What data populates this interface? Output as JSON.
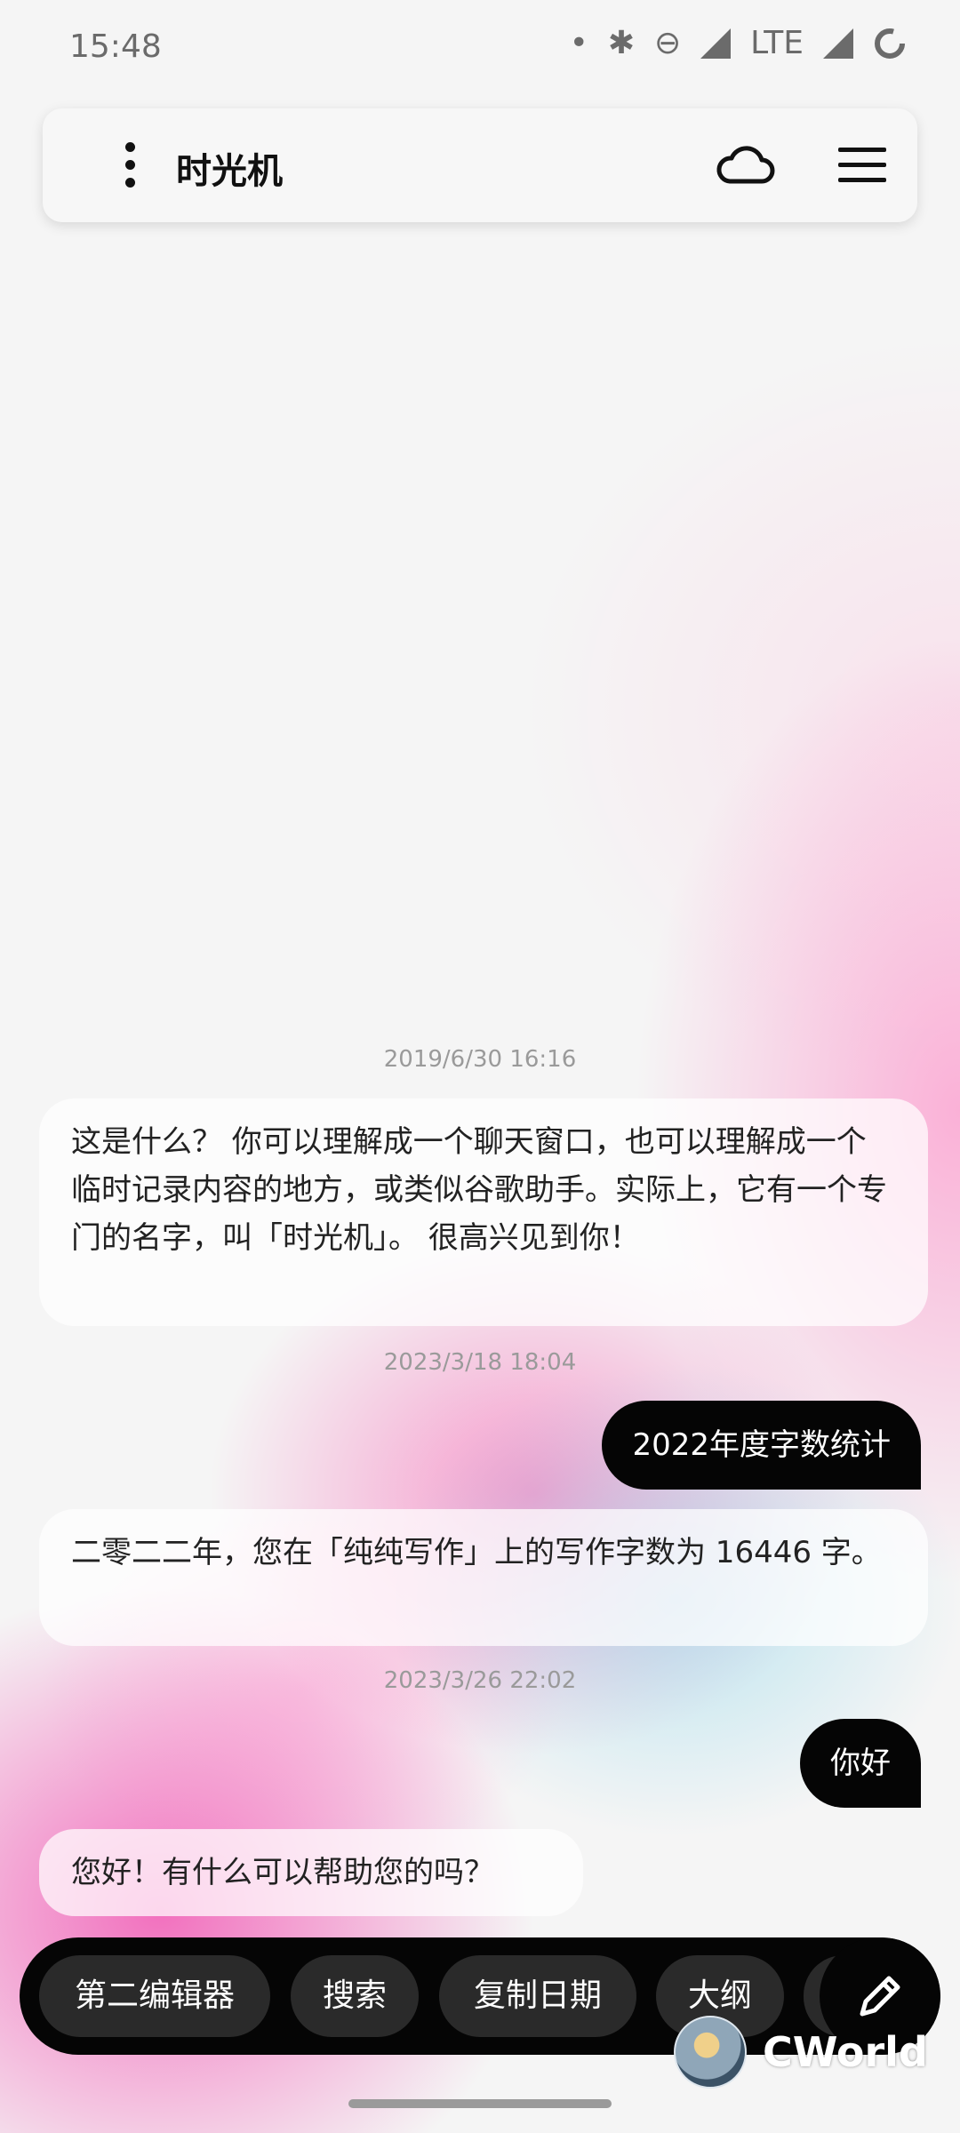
{
  "status_bar": {
    "time": "15:48",
    "network": "LTE"
  },
  "app_bar": {
    "title": "时光机"
  },
  "messages": [
    {
      "timestamp": "2019/6/30 16:16"
    },
    {
      "text": "这是什么？ 你可以理解成一个聊天窗口，也可以理解成一个临时记录内容的地方，或类似谷歌助手。实际上，它有一个专门的名字，叫「时光机」。 很高兴见到你！"
    },
    {
      "timestamp": "2023/3/18 18:04"
    },
    {
      "text": "2022年度字数统计"
    },
    {
      "text": "二零二二年，您在「纯纯写作」上的写作字数为 16446 字。"
    },
    {
      "timestamp": "2023/3/26 22:02"
    },
    {
      "text": "你好"
    },
    {
      "text": "您好！有什么可以帮助您的吗？"
    }
  ],
  "toolbar": {
    "buttons": [
      "第二编辑器",
      "搜索",
      "复制日期",
      "大纲"
    ]
  },
  "watermark": "CWorld",
  "colors": {
    "user_bubble": "#050505",
    "bot_bubble": "#ffffff",
    "accent_pink": "#f02898"
  }
}
